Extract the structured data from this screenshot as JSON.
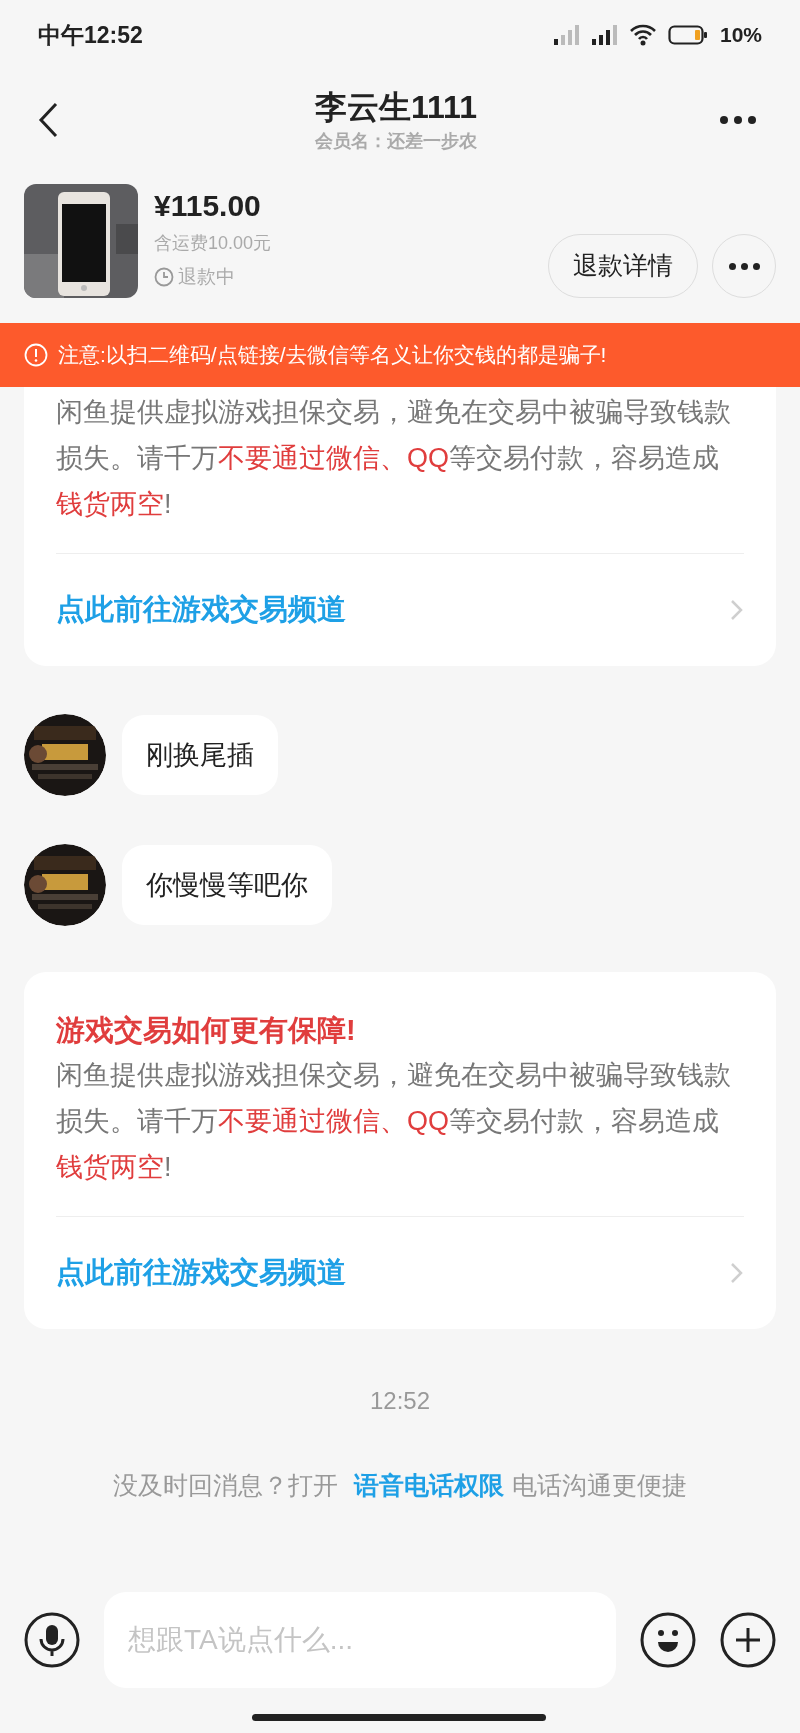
{
  "status_bar": {
    "time": "中午12:52",
    "battery": "10%"
  },
  "header": {
    "title": "李云生1111",
    "subtitle": "会员名：还差一步农"
  },
  "product": {
    "price": "¥115.00",
    "shipping": "含运费10.00元",
    "status": "退款中",
    "button": "退款详情"
  },
  "banner": {
    "text": "注意:以扫二维码/点链接/去微信等名义让你交钱的都是骗子!"
  },
  "messages": [
    {
      "kind": "card",
      "body": [
        {
          "text": "闲鱼提供虚拟游戏担保交易，避免在交易中被骗导致钱款损失。请千万",
          "highlight": false
        },
        {
          "text": "不要通过微信、QQ",
          "highlight": true
        },
        {
          "text": "等交易付款，容易造成",
          "highlight": false
        },
        {
          "text": "钱货两空",
          "highlight": true
        },
        {
          "text": "!",
          "highlight": false
        }
      ],
      "link": "点此前往游戏交易频道"
    },
    {
      "kind": "bubble",
      "text": "刚换尾插"
    },
    {
      "kind": "bubble",
      "text": "你慢慢等吧你"
    },
    {
      "kind": "card",
      "title": "游戏交易如何更有保障!",
      "body": [
        {
          "text": "闲鱼提供虚拟游戏担保交易，避免在交易中被骗导致钱款损失。请千万",
          "highlight": false
        },
        {
          "text": "不要通过微信、QQ",
          "highlight": true
        },
        {
          "text": "等交易付款，容易造成",
          "highlight": false
        },
        {
          "text": "钱货两空",
          "highlight": true
        },
        {
          "text": "!",
          "highlight": false
        }
      ],
      "link": "点此前往游戏交易频道"
    }
  ],
  "timestamp": "12:52",
  "call_prompt": {
    "before": "没及时回消息？打开",
    "link": "语音电话权限",
    "after": "电话沟通更便捷"
  },
  "input": {
    "placeholder": "想跟TA说点什么..."
  }
}
